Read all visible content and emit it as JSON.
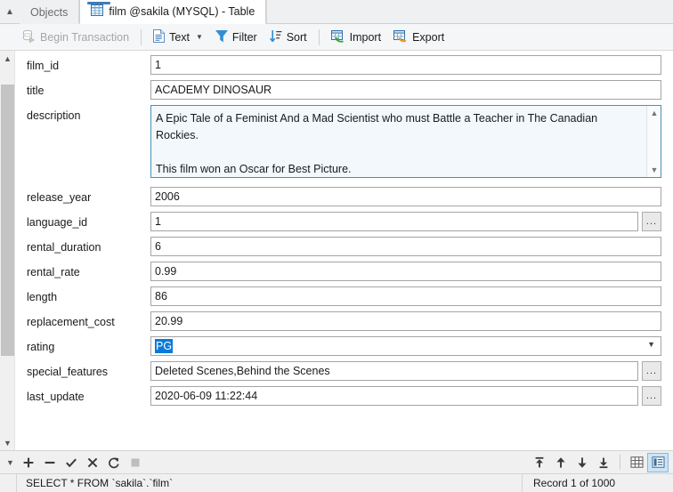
{
  "tabs": {
    "scroll_up_icon": "chevron-up-icon",
    "items": [
      {
        "label": "Objects",
        "active": false,
        "icon": null
      },
      {
        "label": "film @sakila (MYSQL) - Table",
        "active": true,
        "icon": "table-icon"
      }
    ]
  },
  "toolbar": {
    "begin_transaction": {
      "label": "Begin Transaction",
      "icon": "database-play-icon",
      "disabled": true
    },
    "text": {
      "label": "Text",
      "icon": "document-icon",
      "dropdown_icon": "caret-down-icon"
    },
    "filter": {
      "label": "Filter",
      "icon": "funnel-icon"
    },
    "sort": {
      "label": "Sort",
      "icon": "sort-descending-icon"
    },
    "import": {
      "label": "Import",
      "icon": "table-import-icon"
    },
    "export": {
      "label": "Export",
      "icon": "table-export-icon"
    }
  },
  "form": {
    "fields": [
      {
        "label": "film_id",
        "value": "1",
        "type": "text"
      },
      {
        "label": "title",
        "value": "ACADEMY DINOSAUR",
        "type": "text"
      },
      {
        "label": "description",
        "value": "A Epic Tale of a Feminist And a Mad Scientist who must Battle a Teacher in The Canadian Rockies.\n\nThis film won an Oscar for Best Picture.",
        "type": "textarea"
      },
      {
        "label": "release_year",
        "value": "2006",
        "type": "text"
      },
      {
        "label": "language_id",
        "value": "1",
        "type": "text",
        "ellipsis": true
      },
      {
        "label": "rental_duration",
        "value": "6",
        "type": "text"
      },
      {
        "label": "rental_rate",
        "value": "0.99",
        "type": "text"
      },
      {
        "label": "length",
        "value": "86",
        "type": "text"
      },
      {
        "label": "replacement_cost",
        "value": "20.99",
        "type": "text"
      },
      {
        "label": "rating",
        "value": "PG",
        "type": "combo",
        "selected": true
      },
      {
        "label": "special_features",
        "value": "Deleted Scenes,Behind the Scenes",
        "type": "text",
        "ellipsis": true
      },
      {
        "label": "last_update",
        "value": "2020-06-09 11:22:44",
        "type": "text",
        "ellipsis": true
      }
    ],
    "ellipsis_label": "...",
    "scrollbar": {
      "up_icon": "chevron-up-icon",
      "down_icon": "chevron-down-icon"
    }
  },
  "navbar": {
    "overflow_icon": "chevron-down-icon",
    "left_buttons": [
      {
        "name": "add-record-button",
        "icon": "plus-icon",
        "glyph": "+",
        "disabled": false
      },
      {
        "name": "delete-record-button",
        "icon": "minus-icon",
        "glyph": "−",
        "disabled": false
      },
      {
        "name": "confirm-edit-button",
        "icon": "check-icon",
        "glyph": "✓",
        "disabled": false
      },
      {
        "name": "cancel-edit-button",
        "icon": "cross-icon",
        "glyph": "✕",
        "disabled": false
      },
      {
        "name": "refresh-button",
        "icon": "refresh-icon",
        "glyph": "⟳",
        "disabled": false
      },
      {
        "name": "stop-button",
        "icon": "stop-icon",
        "glyph": "■",
        "disabled": true
      }
    ],
    "right_buttons": [
      {
        "name": "first-record-button",
        "icon": "first-record-icon"
      },
      {
        "name": "prev-record-button",
        "icon": "arrow-up-icon"
      },
      {
        "name": "next-record-button",
        "icon": "arrow-down-icon"
      },
      {
        "name": "last-record-button",
        "icon": "last-record-icon"
      }
    ],
    "view_toggles": [
      {
        "name": "grid-view-toggle",
        "icon": "grid-view-icon",
        "active": false
      },
      {
        "name": "form-view-toggle",
        "icon": "form-view-icon",
        "active": true
      }
    ]
  },
  "statusbar": {
    "sql": "SELECT * FROM `sakila`.`film`",
    "record": "Record 1 of 1000"
  },
  "colors": {
    "accent": "#3d7eb8",
    "selection": "#0a7ada",
    "toggle_active_bg": "#cce4f7",
    "textarea_bg": "#f2f8fc",
    "textarea_border": "#4a90b8",
    "toolbar_bg": "#f5f6f7",
    "tabstrip_bg": "#eff0f1"
  }
}
